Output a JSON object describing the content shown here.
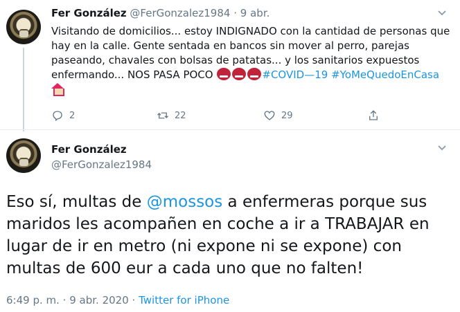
{
  "tweet_1": {
    "author_name": "Fer González",
    "handle": "@FerGonzalez1984",
    "separator": "·",
    "date": "9 abr.",
    "text_part1": "Visitando de domicilios... estoy INDIGNADO con la cantidad de personas que hay en la calle. Gente sentada en bancos sin mover al perro, parejas paseando, chavales con bolsas de patatas... y los sanitarios expuestos enfermando... NOS PASA POCO",
    "hashtag_1": "#COVID—19",
    "hashtag_2": "#YoMeQuedoEnCasa",
    "emoji_icon": "face-with-symbols-on-mouth-icon",
    "home_icon": "house-icon",
    "actions": {
      "replies": "2",
      "retweets": "22",
      "likes": "29"
    }
  },
  "tweet_2": {
    "author_name": "Fer González",
    "handle": "@FerGonzalez1984",
    "text_before_mention": "Eso sí, multas de ",
    "mention": "@mossos",
    "text_after_mention": " a enfermeras porque sus maridos les acompañen en coche a ir a TRABAJAR en lugar de ir en metro  (ni expone ni se expone) con multas de 600 eur a cada uno que no falten!",
    "footer_time": "6:49 p. m.",
    "footer_sep": "·",
    "footer_date": "9 abr. 2020",
    "footer_sep2": "·",
    "footer_source": "Twitter for iPhone"
  },
  "colors": {
    "link": "#1b95e0",
    "secondary_text": "#657786",
    "divider": "#e6ecf0"
  }
}
